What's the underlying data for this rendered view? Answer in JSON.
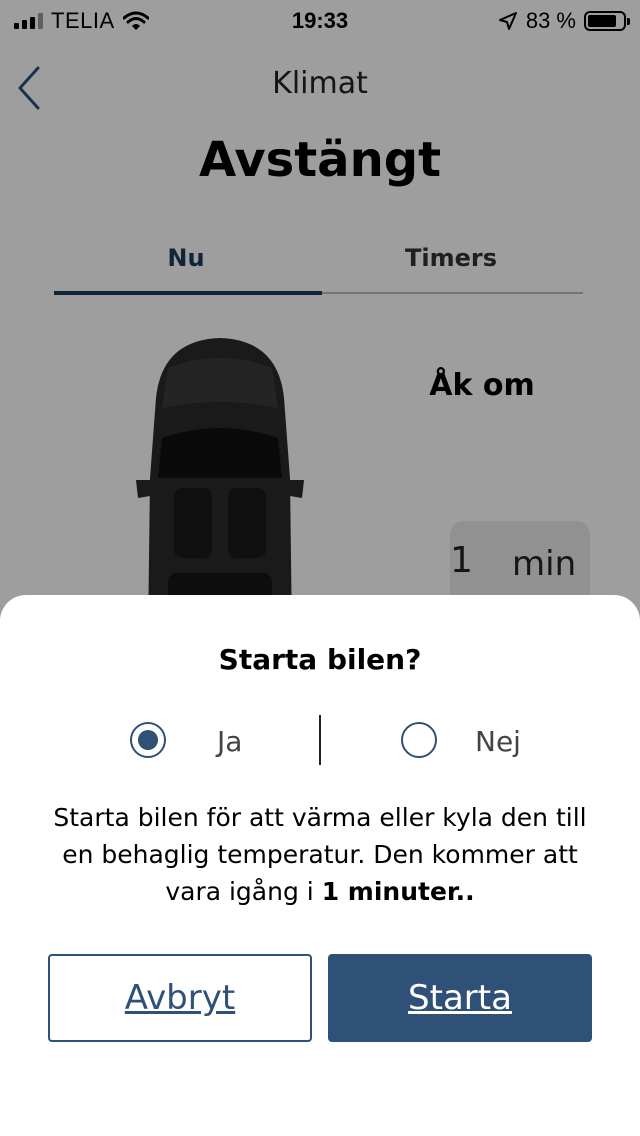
{
  "status_bar": {
    "carrier": "TELIA",
    "time": "19:33",
    "battery_percent": "83 %",
    "battery_level": 0.83
  },
  "header": {
    "title": "Klimat",
    "status": "Avstängt"
  },
  "tabs": [
    {
      "label": "Nu",
      "active": true
    },
    {
      "label": "Timers",
      "active": false
    }
  ],
  "main": {
    "restart_label": "Åk om",
    "duration_value": "1",
    "duration_unit": "min"
  },
  "dialog": {
    "title": "Starta bilen?",
    "options": [
      {
        "label": "Ja",
        "selected": true
      },
      {
        "label": "Nej",
        "selected": false
      }
    ],
    "description": "Starta bilen för att värma eller kyla den till en behaglig temperatur. Den kommer att vara igång i",
    "description_emphasis": "1 minuter..",
    "cancel_label": "Avbryt",
    "start_label": "Starta"
  },
  "colors": {
    "accent": "#2f5177",
    "tab_active": "#1d3a5c"
  },
  "icons": [
    "signal-icon",
    "wifi-icon",
    "location-arrow-icon",
    "battery-icon",
    "back-chevron-icon",
    "radio-selected-icon",
    "radio-unselected-icon"
  ]
}
